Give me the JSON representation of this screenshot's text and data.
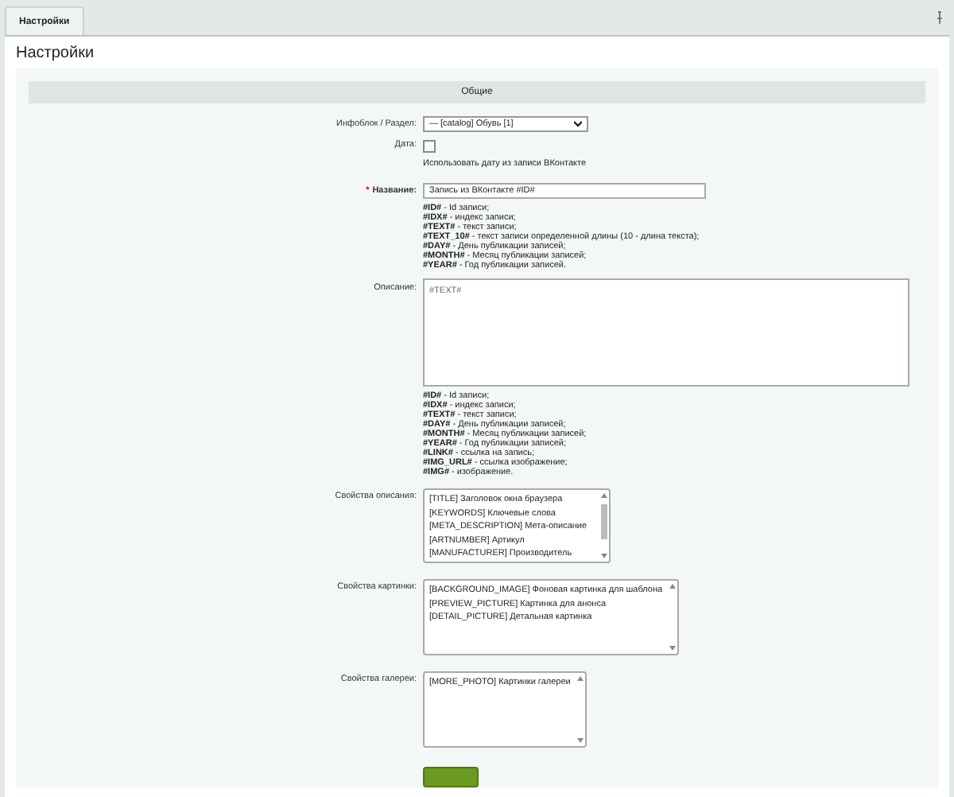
{
  "tabs": [
    {
      "label": "Настройки",
      "selected": true
    }
  ],
  "title": "Настройки",
  "section": "Общие",
  "fields": [
    {
      "kind": "select",
      "label": "Инфоблок / Раздел:",
      "value": "— [catalog] Обувь [1]"
    },
    {
      "kind": "checkbox",
      "label": "Дата:",
      "checked": false,
      "note": "Использовать дату из записи ВКонтакте"
    },
    {
      "kind": "input",
      "label": "Название:",
      "required_mark": "*",
      "value": "Запись из ВКонтакте #ID#",
      "hints": [
        "**#ID#** - Id записи;",
        "**#IDX#** - индекс записи;",
        "**#TEXT#** - текст записи;",
        "**#TEXT_10#** - текст записи определенной длины (10 - длина текста);",
        "**#DAY#** - День публикации записей;",
        "**#MONTH#** - Месяц публикации записей;",
        "**#YEAR#** - Год публикации записей."
      ]
    },
    {
      "kind": "textarea",
      "label": "Описание:",
      "value": "#TEXT#",
      "hints": [
        "**#ID#** - Id записи;",
        "**#IDX#** - индекс записи;",
        "**#TEXT#** - текст записи;",
        "**#DAY#** - День публикации записей;",
        "**#MONTH#** - Месяц публикации записей;",
        "**#YEAR#** - Год публикации записей;",
        "**#LINK#** - ссылка на запись;",
        "**#IMG_URL#** - ссылка изображение;",
        "**#IMG#** - изображение."
      ]
    },
    {
      "kind": "list",
      "label": "Свойства описания:",
      "options": [
        "[TITLE] Заголовок окна браузера",
        "[KEYWORDS] Ключевые слова",
        "[META_DESCRIPTION] Мета-описание",
        "[ARTNUMBER] Артикул",
        "[MANUFACTURER] Производитель"
      ]
    },
    {
      "kind": "list",
      "label": "Свойства картинки:",
      "options": [
        "[BACKGROUND_IMAGE] Фоновая картинка для шаблона",
        "[PREVIEW_PICTURE] Картинка для анонса",
        "[DETAIL_PICTURE] Детальная картинка"
      ]
    },
    {
      "kind": "list",
      "label": "Свойства галереи:",
      "options": [
        "[MORE_PHOTO] Картинки галереи"
      ]
    }
  ]
}
